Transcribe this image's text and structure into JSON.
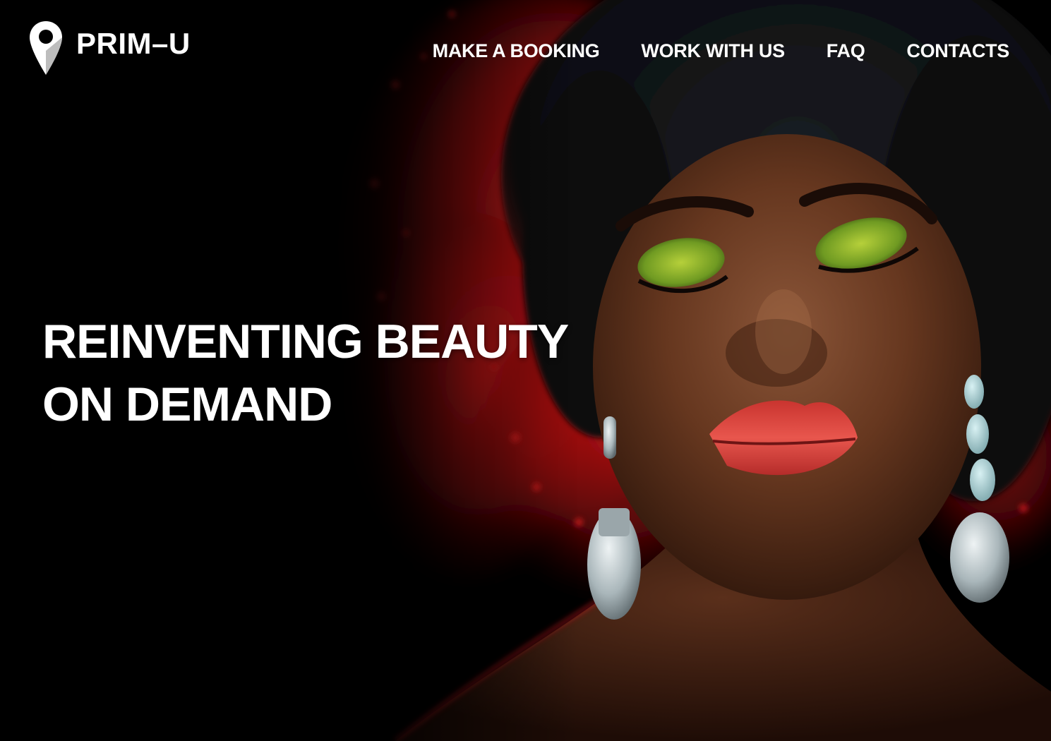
{
  "brand": {
    "name": "PRIM–U",
    "icon": "map-pin-icon"
  },
  "nav": {
    "items": [
      {
        "label": "MAKE A BOOKING"
      },
      {
        "label": "WORK WITH US"
      },
      {
        "label": "FAQ"
      },
      {
        "label": "CONTACTS"
      }
    ]
  },
  "hero": {
    "headline_line1": "REINVENTING BEAUTY",
    "headline_line2": "ON DEMAND"
  },
  "colors": {
    "background": "#000000",
    "text": "#ffffff",
    "accent_red": "#c4141a",
    "skin": "#6a3a24",
    "eyeshadow_green": "#8fb52a",
    "lips": "#d8443e",
    "earring_silver": "#c9d3d6"
  }
}
